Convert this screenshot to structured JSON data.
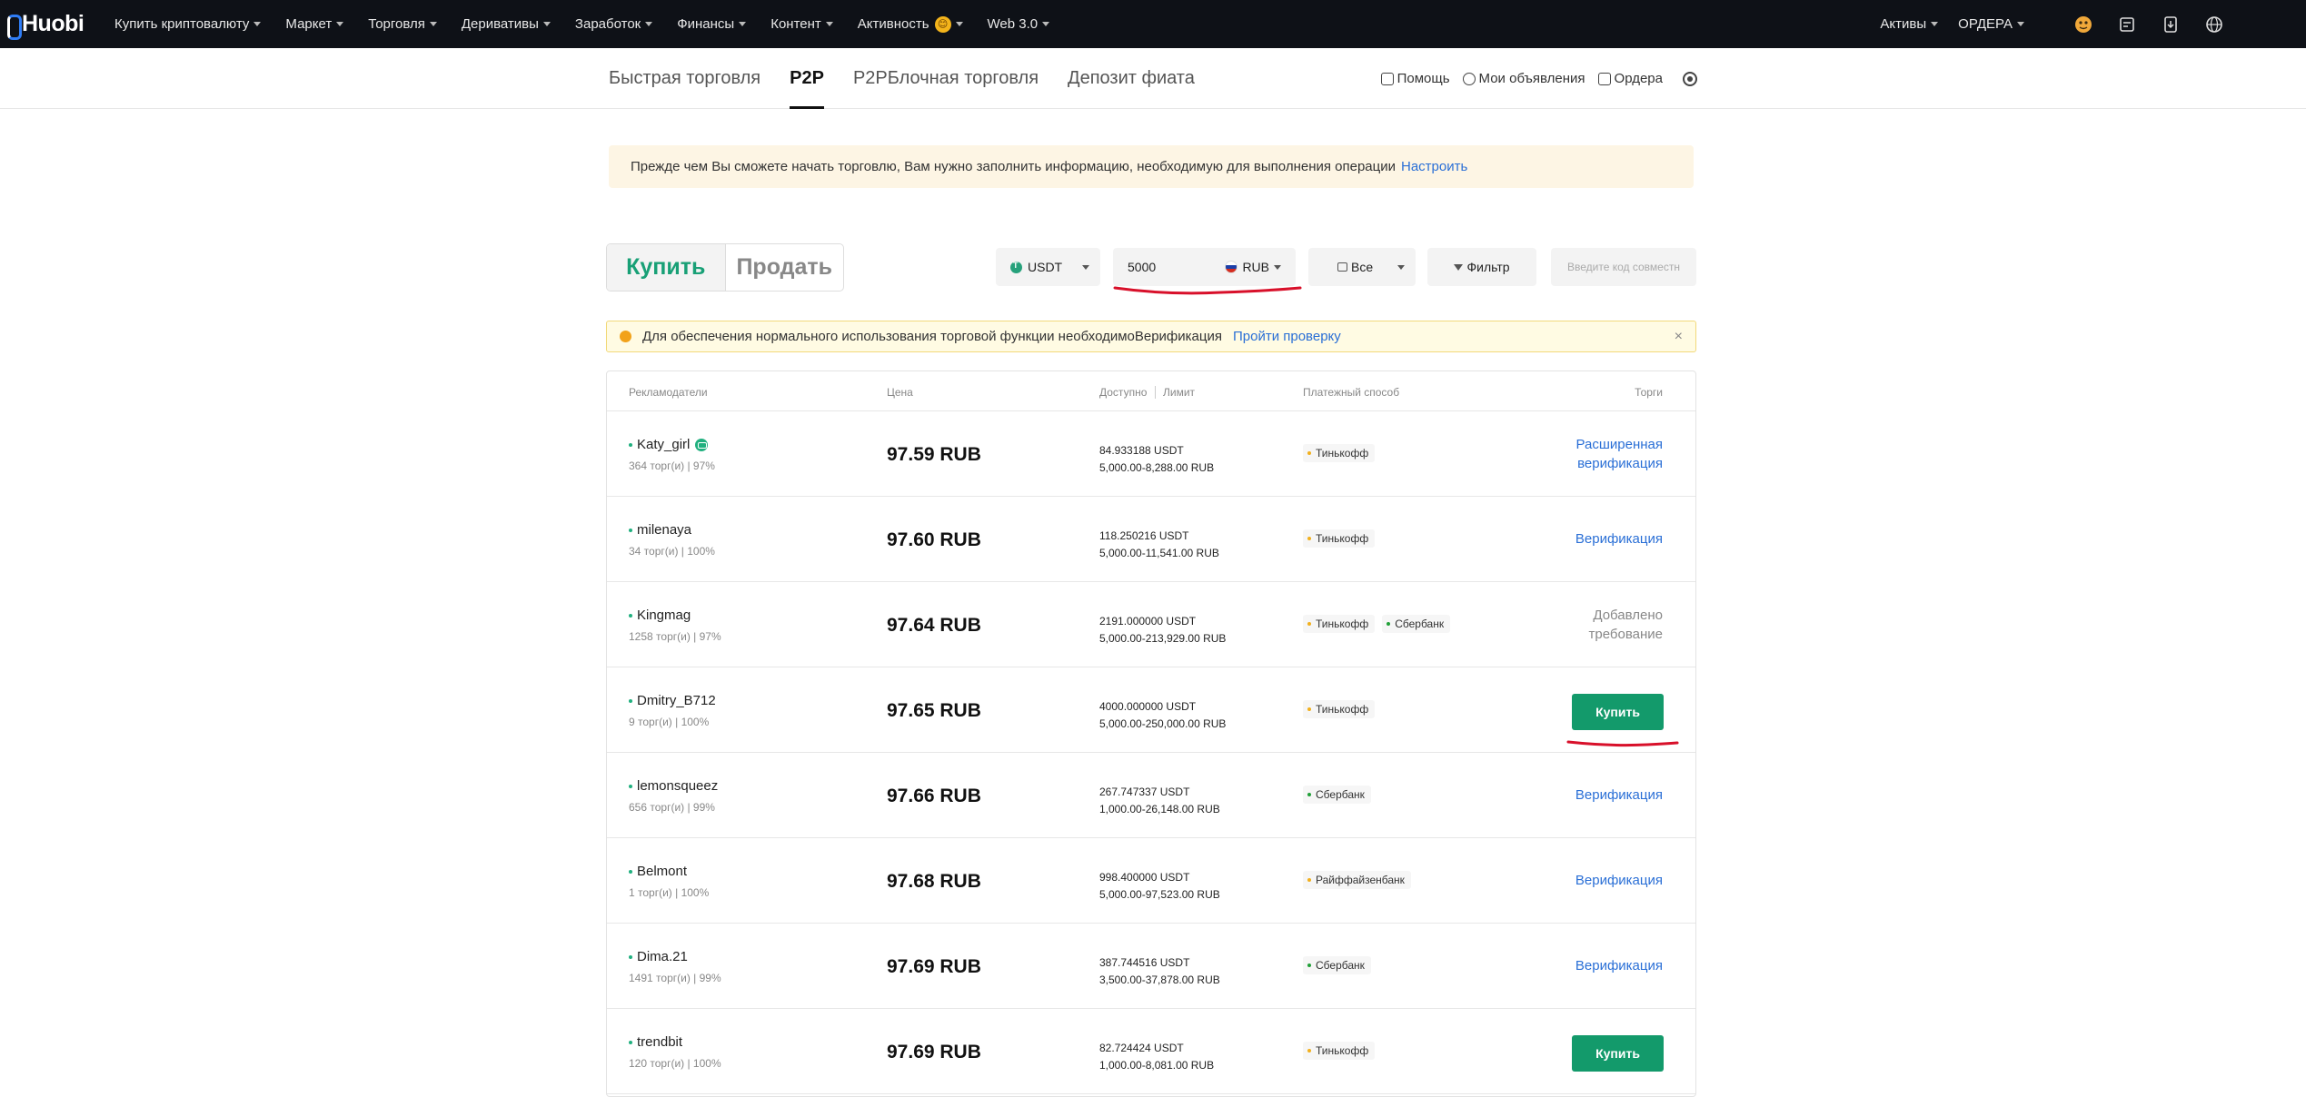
{
  "topnav": {
    "logo": "Huobi",
    "menu": [
      {
        "label": "Купить криптовалюту",
        "caret": true
      },
      {
        "label": "Маркет",
        "caret": true
      },
      {
        "label": "Торговля",
        "caret": true
      },
      {
        "label": "Деривативы",
        "caret": true
      },
      {
        "label": "Заработок",
        "caret": true
      },
      {
        "label": "Финансы",
        "caret": true
      },
      {
        "label": "Контент",
        "caret": true
      },
      {
        "label": "Активность",
        "caret": true
      },
      {
        "label": "Web 3.0",
        "caret": true
      }
    ],
    "activity_badge": "😊",
    "assets_label": "Активы",
    "orders_label": "ОРДЕРА",
    "icons": [
      "avatar-icon",
      "document-icon",
      "download-icon",
      "globe-icon"
    ]
  },
  "subnav": {
    "tabs": [
      "Быстрая торговля",
      "P2P",
      "P2PБлочная торговля",
      "Депозит фиата"
    ],
    "active_tab": "P2P",
    "links": [
      "Помощь",
      "Мои объявления",
      "Ордера"
    ]
  },
  "info_banner": {
    "text": "Прежде чем Вы сможете начать торговлю, Вам нужно заполнить информацию, необходимую для выполнения операции",
    "link": "Настроить"
  },
  "controls": {
    "buy_label": "Купить",
    "sell_label": "Продать",
    "coin": "USDT",
    "amount": "5000",
    "currency": "RUB",
    "payment_filter": "Все",
    "filter_label": "Фильтр",
    "code_placeholder": "Введите код совместн"
  },
  "warn_banner": {
    "text": "Для обеспечения нормального использования торговой функции необходимоВерификация",
    "link": "Пройти проверку",
    "close": "×"
  },
  "table": {
    "headers": {
      "advertiser": "Рекламодатели",
      "price": "Цена",
      "available": "Доступно",
      "limit": "Лимит",
      "payment": "Платежный способ",
      "trade": "Торги"
    },
    "rows": [
      {
        "name": "Katy_girl",
        "verified": true,
        "stats": "364 торг(и) | 97%",
        "price": "97.59 RUB",
        "available": "84.933188 USDT",
        "limit": "5,000.00-8,288.00 RUB",
        "payments": [
          {
            "name": "Тинькофф",
            "color": "#f2b01e"
          }
        ],
        "action": {
          "type": "link",
          "line1": "Расширенная",
          "line2": "верификация"
        }
      },
      {
        "name": "milenaya",
        "verified": false,
        "stats": "34 торг(и) | 100%",
        "price": "97.60 RUB",
        "available": "118.250216 USDT",
        "limit": "5,000.00-11,541.00 RUB",
        "payments": [
          {
            "name": "Тинькофф",
            "color": "#f2b01e"
          }
        ],
        "action": {
          "type": "link",
          "line1": "Верификация",
          "line2": ""
        }
      },
      {
        "name": "Kingmag",
        "verified": false,
        "stats": "1258 торг(и) | 97%",
        "price": "97.64 RUB",
        "available": "2191.000000 USDT",
        "limit": "5,000.00-213,929.00 RUB",
        "payments": [
          {
            "name": "Тинькофф",
            "color": "#f2b01e"
          },
          {
            "name": "Сбербанк",
            "color": "#21a038"
          }
        ],
        "action": {
          "type": "muted",
          "line1": "Добавлено",
          "line2": "требование"
        }
      },
      {
        "name": "Dmitry_B712",
        "verified": false,
        "stats": "9 торг(и) | 100%",
        "price": "97.65 RUB",
        "available": "4000.000000 USDT",
        "limit": "5,000.00-250,000.00 RUB",
        "payments": [
          {
            "name": "Тинькофф",
            "color": "#f2b01e"
          }
        ],
        "action": {
          "type": "button",
          "line1": "Купить",
          "line2": ""
        }
      },
      {
        "name": "lemonsqueez",
        "verified": false,
        "stats": "656 торг(и) | 99%",
        "price": "97.66 RUB",
        "available": "267.747337 USDT",
        "limit": "1,000.00-26,148.00 RUB",
        "payments": [
          {
            "name": "Сбербанк",
            "color": "#21a038"
          }
        ],
        "action": {
          "type": "link",
          "line1": "Верификация",
          "line2": ""
        }
      },
      {
        "name": "Belmont",
        "verified": false,
        "stats": "1 торг(и) | 100%",
        "price": "97.68 RUB",
        "available": "998.400000 USDT",
        "limit": "5,000.00-97,523.00 RUB",
        "payments": [
          {
            "name": "Райффайзенбанк",
            "color": "#f2b01e"
          }
        ],
        "action": {
          "type": "link",
          "line1": "Верификация",
          "line2": ""
        }
      },
      {
        "name": "Dima.21",
        "verified": false,
        "stats": "1491 торг(и) | 99%",
        "price": "97.69 RUB",
        "available": "387.744516 USDT",
        "limit": "3,500.00-37,878.00 RUB",
        "payments": [
          {
            "name": "Сбербанк",
            "color": "#21a038"
          }
        ],
        "action": {
          "type": "link",
          "line1": "Верификация",
          "line2": ""
        }
      },
      {
        "name": "trendbit",
        "verified": false,
        "stats": "120 торг(и) | 100%",
        "price": "97.69 RUB",
        "available": "82.724424 USDT",
        "limit": "1,000.00-8,081.00 RUB",
        "payments": [
          {
            "name": "Тинькофф",
            "color": "#f2b01e"
          }
        ],
        "action": {
          "type": "button",
          "line1": "Купить",
          "line2": ""
        }
      }
    ]
  },
  "colors": {
    "accent_green": "#139a6b",
    "link_blue": "#2a6fd6",
    "annotation_red": "#d8102a",
    "topnav_bg": "#0e1117"
  }
}
